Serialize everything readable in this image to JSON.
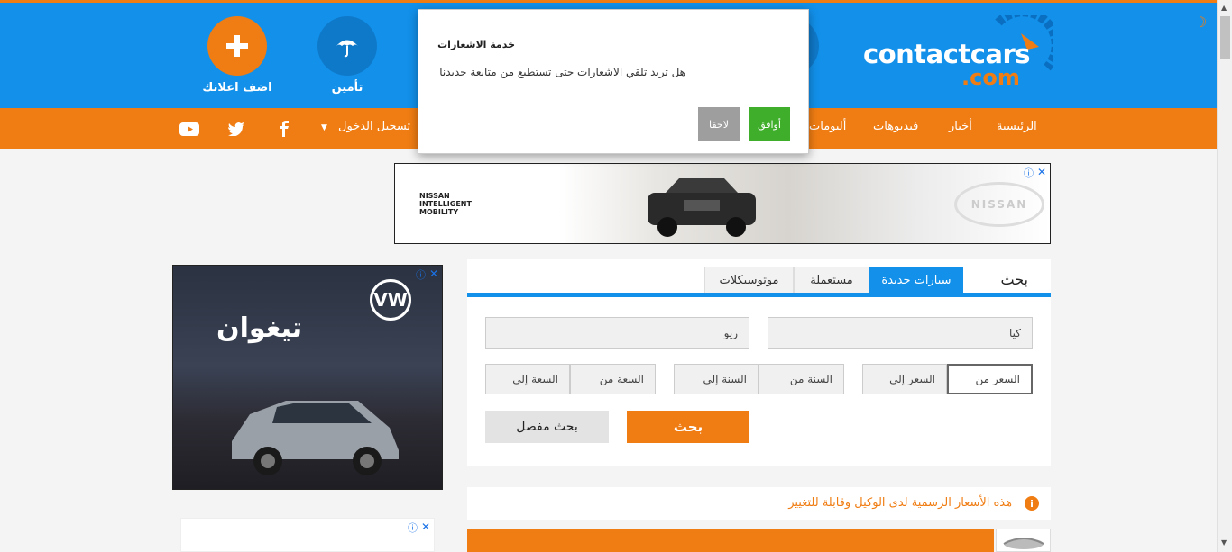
{
  "header": {
    "logo_main": "contactcars",
    "logo_com": ".com",
    "add_ad_label": "اضف اعلانك",
    "insurance_label": "تأمين"
  },
  "nav": {
    "items": [
      "الرئيسية",
      "أخبار",
      "فيديوهات",
      "ألبومات"
    ],
    "login": "تسجيل الدخول"
  },
  "notification_modal": {
    "title": "خدمة الاشعارات",
    "body": "هل تريد تلقي الاشعارات حتى تستطيع من متابعة جديدنا",
    "later_label": "لاحقا",
    "agree_label": "أوافق"
  },
  "ads": {
    "top_brand_text": "NISSAN INTELLIGENT MOBILITY",
    "top_brand_badge": "NISSAN",
    "side_title": "تيغوان",
    "side_brand": "VW"
  },
  "search": {
    "title": "بحث",
    "tabs": [
      "سيارات جديدة",
      "مستعملة",
      "موتوسيكلات"
    ],
    "active_tab": "سيارات جديدة",
    "make_value": "كيا",
    "model_value": "ريو",
    "price_from": "السعر من",
    "price_to": "السعر إلى",
    "year_from": "السنة من",
    "year_to": "السنة إلى",
    "capacity_from": "السعة من",
    "capacity_to": "السعة إلى",
    "search_button": "بحث",
    "advanced_button": "بحث مفصل"
  },
  "notice": {
    "text": "هذه الأسعار الرسمية لدى الوكيل وقابلة للتغيير"
  },
  "colors": {
    "primary_blue": "#1290ea",
    "accent_orange": "#f07d13",
    "agree_green": "#3fae2a"
  }
}
